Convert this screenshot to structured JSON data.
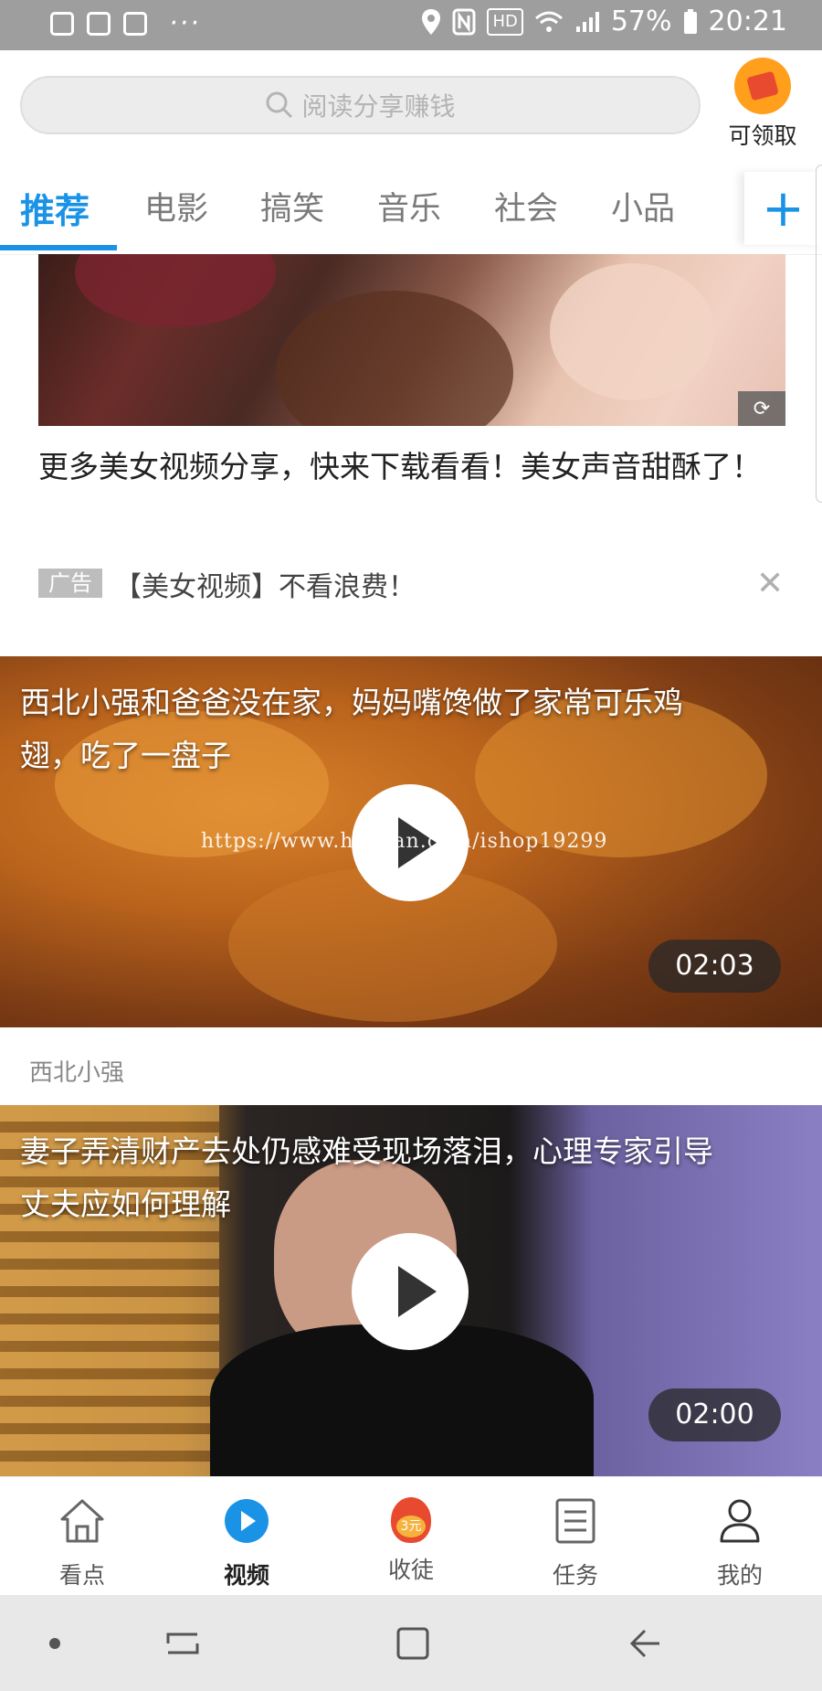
{
  "status_bar": {
    "battery": "57%",
    "time": "20:21",
    "hd_label": "HD",
    "dots": "···"
  },
  "search": {
    "placeholder": "阅读分享赚钱",
    "icon": "search-icon"
  },
  "reward": {
    "label": "可领取",
    "icon": "red-envelope-icon"
  },
  "tabs": [
    {
      "label": "推荐",
      "active": true
    },
    {
      "label": "电影",
      "active": false
    },
    {
      "label": "搞笑",
      "active": false
    },
    {
      "label": "音乐",
      "active": false
    },
    {
      "label": "社会",
      "active": false
    },
    {
      "label": "小品",
      "active": false
    }
  ],
  "tab_add_label": "+",
  "ad": {
    "title": "更多美女视频分享，快来下载看看！美女声音甜酥了！",
    "tag": "广告",
    "description": "【美女视频】不看浪费！",
    "close": "✕"
  },
  "videos": [
    {
      "title": "西北小强和爸爸没在家，妈妈嘴馋做了家常可乐鸡翅，吃了一盘子",
      "duration": "02:03",
      "author": "西北小强",
      "watermark": "https://www.huzhan.com/ishop19299"
    },
    {
      "title": "妻子弄清财产去处仍感难受现场落泪，心理专家引导丈夫应如何理解",
      "duration": "02:00"
    }
  ],
  "bottom_nav": [
    {
      "label": "看点",
      "icon": "home-icon",
      "active": false
    },
    {
      "label": "视频",
      "icon": "play-circle-icon",
      "active": true
    },
    {
      "label": "收徒",
      "icon": "red-envelope-icon",
      "badge": "3元",
      "active": false
    },
    {
      "label": "任务",
      "icon": "task-list-icon",
      "active": false
    },
    {
      "label": "我的",
      "icon": "user-icon",
      "active": false
    }
  ],
  "colors": {
    "accent": "#1a93e6",
    "status_bar": "#9e9e9e"
  }
}
